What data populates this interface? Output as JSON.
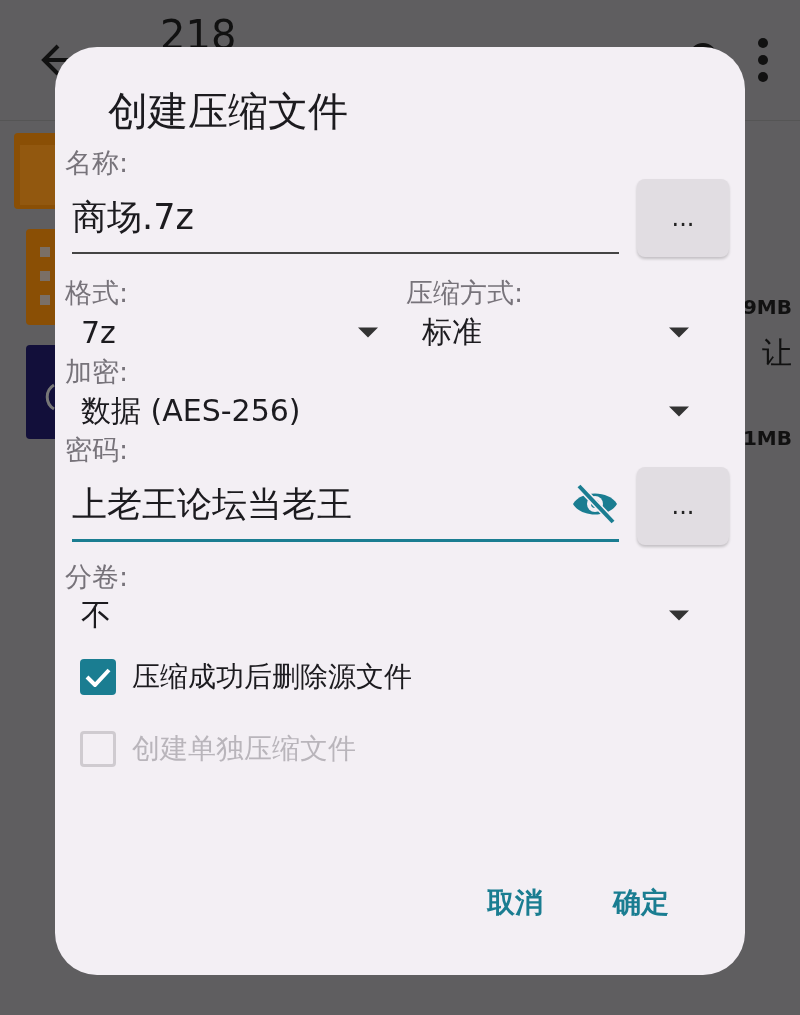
{
  "background": {
    "title": "218",
    "side_texts": [
      "9MB",
      "让",
      "1MB"
    ]
  },
  "dialog": {
    "title": "创建压缩文件",
    "name": {
      "label": "名称:",
      "value": "商场.7z",
      "button": "..."
    },
    "format": {
      "label": "格式:",
      "value": "7z"
    },
    "method": {
      "label": "压缩方式:",
      "value": "标准"
    },
    "encryption": {
      "label": "加密:",
      "value": "数据 (AES-256)"
    },
    "password": {
      "label": "密码:",
      "value": "上老王论坛当老王",
      "focused": true,
      "button": "..."
    },
    "split": {
      "label": "分卷:",
      "value": "不"
    },
    "checkboxes": [
      {
        "label": "压缩成功后删除源文件",
        "checked": true,
        "disabled": false
      },
      {
        "label": "创建单独压缩文件",
        "checked": false,
        "disabled": true
      }
    ],
    "buttons": [
      "取消",
      "确定"
    ]
  }
}
